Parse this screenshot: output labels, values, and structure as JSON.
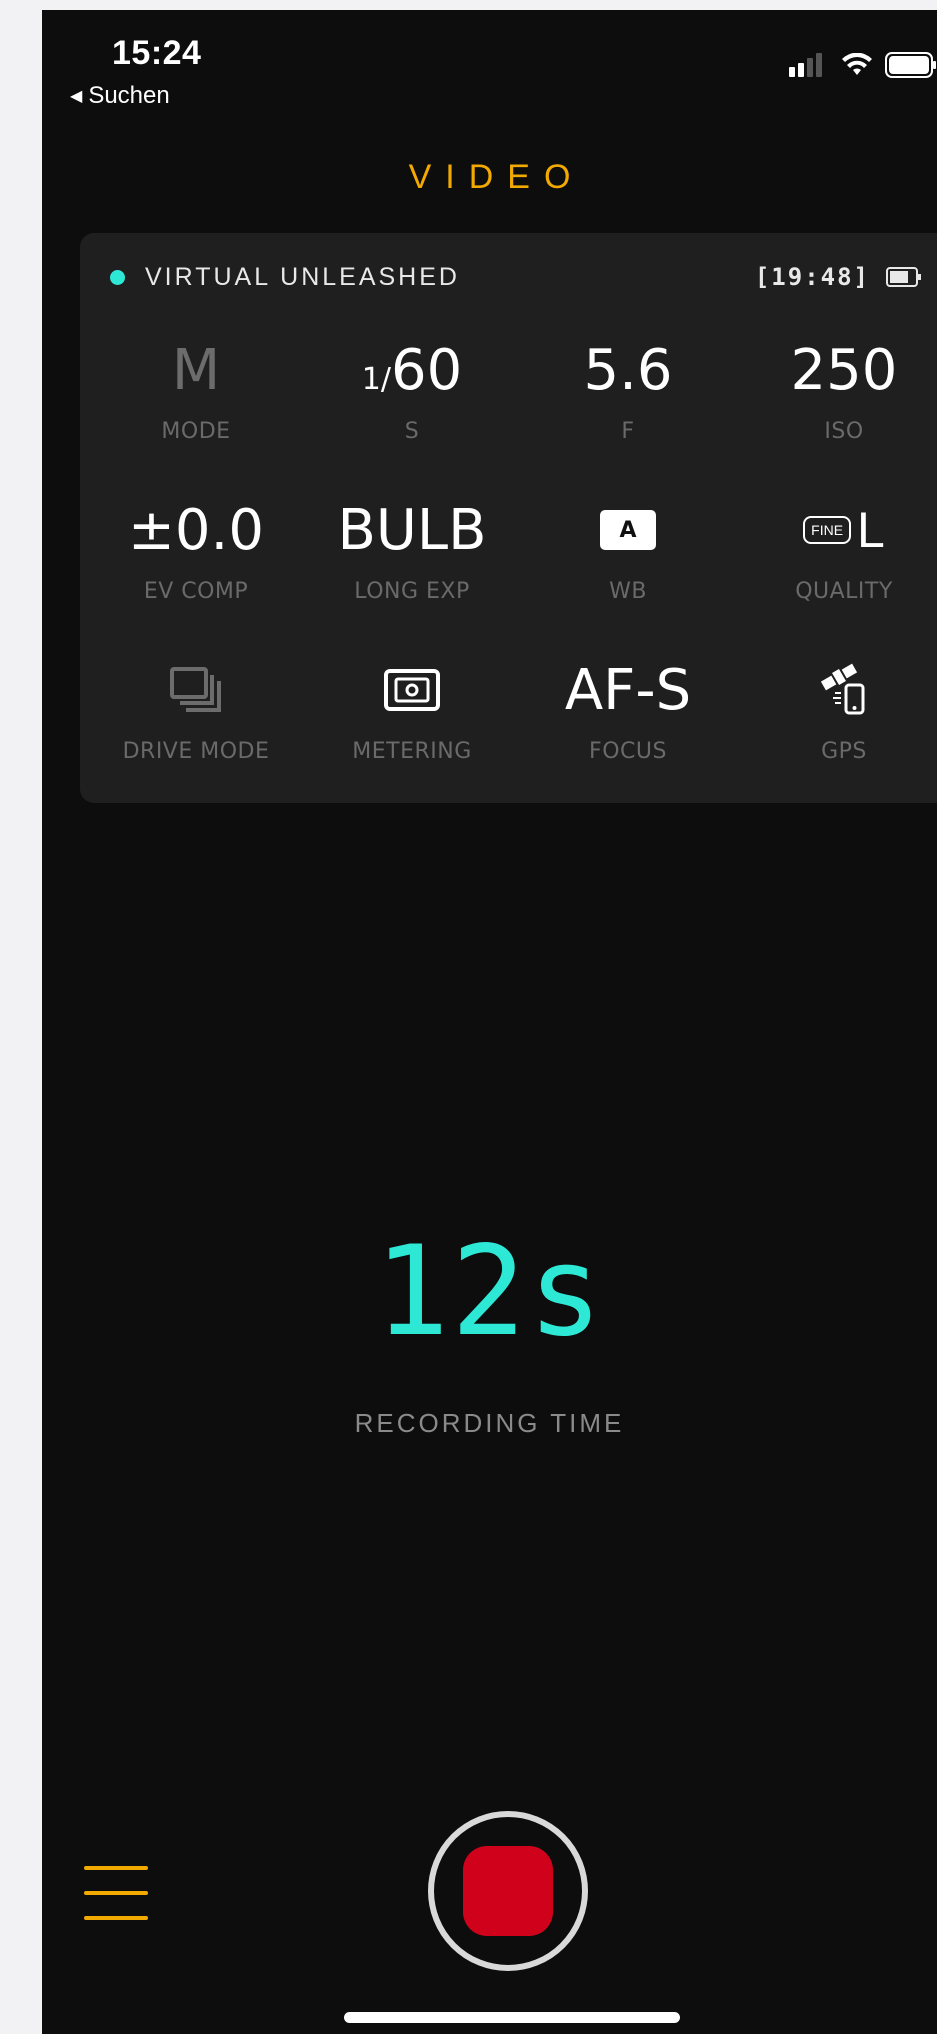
{
  "status_bar": {
    "time": "15:24",
    "back_label": "Suchen"
  },
  "header": {
    "title": "VIDEO",
    "accent": "#f2a900"
  },
  "camera": {
    "name": "VIRTUAL UNLEASHED",
    "remaining": "[19:48]",
    "status_color": "#2ee8d6"
  },
  "settings": {
    "mode": {
      "value": "M",
      "label": "MODE"
    },
    "shutter": {
      "prefix": "1/",
      "value": "60",
      "label": "S"
    },
    "aperture": {
      "value": "5.6",
      "label": "F"
    },
    "iso": {
      "value": "250",
      "label": "ISO"
    },
    "ev_comp": {
      "value": "±0.0",
      "label": "EV COMP"
    },
    "long_exp": {
      "value": "BULB",
      "label": "LONG EXP"
    },
    "wb": {
      "value": "A",
      "label": "WB"
    },
    "quality": {
      "badge": "FINE",
      "value": "L",
      "label": "QUALITY"
    },
    "drive_mode": {
      "icon": "drive-mode-icon",
      "label": "DRIVE MODE"
    },
    "metering": {
      "icon": "metering-icon",
      "label": "METERING"
    },
    "focus": {
      "value": "AF-S",
      "label": "FOCUS"
    },
    "gps": {
      "icon": "gps-satellite-icon",
      "label": "GPS"
    }
  },
  "recording": {
    "time": "12s",
    "label": "RECORDING TIME",
    "record_color": "#d0021b"
  }
}
